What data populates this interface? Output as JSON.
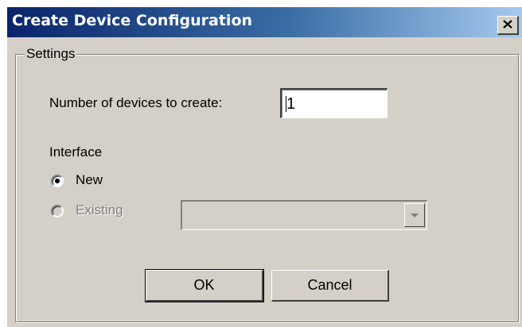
{
  "window": {
    "title": "Create Device Configuration",
    "close_icon": "close-icon"
  },
  "settings": {
    "group_label": "Settings",
    "device_count_label": "Number of devices to create:",
    "device_count_value": "1",
    "interface_label": "Interface",
    "radio_new_label": "New",
    "radio_new_selected": true,
    "radio_existing_label": "Existing",
    "radio_existing_enabled": false,
    "existing_interface_value": "",
    "existing_interface_enabled": false
  },
  "buttons": {
    "ok_label": "OK",
    "cancel_label": "Cancel"
  },
  "colors": {
    "dialog_face": "#d4d0c8",
    "titlebar_start": "#0a246a",
    "titlebar_end": "#a6caf0",
    "disabled_text": "#808080"
  }
}
